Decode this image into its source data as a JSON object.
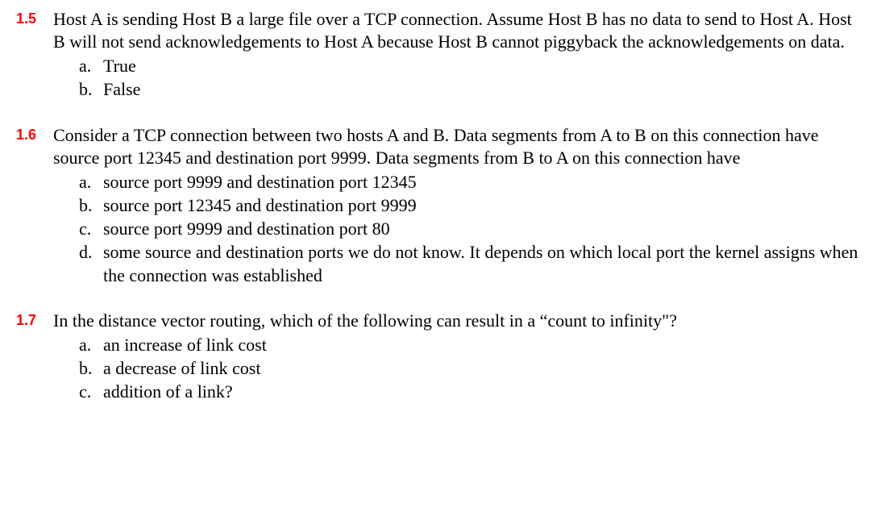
{
  "questions": [
    {
      "number": "1.5",
      "text": "Host A is sending Host B a large file over a TCP connection. Assume Host B has no data to send to Host  A. Host B will not send acknowledgements to Host A because Host B cannot piggyback the acknowledgements on data.",
      "options": [
        {
          "letter": "a.",
          "text": "True"
        },
        {
          "letter": "b.",
          "text": "False"
        }
      ]
    },
    {
      "number": "1.6",
      "text": "Consider a TCP connection between two hosts A and B. Data segments from A  to B  on this connection have source port 12345 and destination port 9999. Data segments from B to A on this connection have",
      "options": [
        {
          "letter": "a.",
          "text": "source port 9999  and destination port 12345"
        },
        {
          "letter": "b.",
          "text": "source port 12345  and destination port 9999"
        },
        {
          "letter": "c.",
          "text": "source port 9999  and destination port 80"
        },
        {
          "letter": "d.",
          "text": "some source and destination ports we do not know. It depends on which local port the kernel assigns when the connection was established"
        }
      ]
    },
    {
      "number": "1.7",
      "text": "In the distance vector routing, which of the following can result in a “count to infinity\"?",
      "options": [
        {
          "letter": "a.",
          "text": "an increase of link cost"
        },
        {
          "letter": "b.",
          "text": "a decrease of link cost"
        },
        {
          "letter": "c.",
          "text": "addition of a link?"
        }
      ]
    }
  ]
}
